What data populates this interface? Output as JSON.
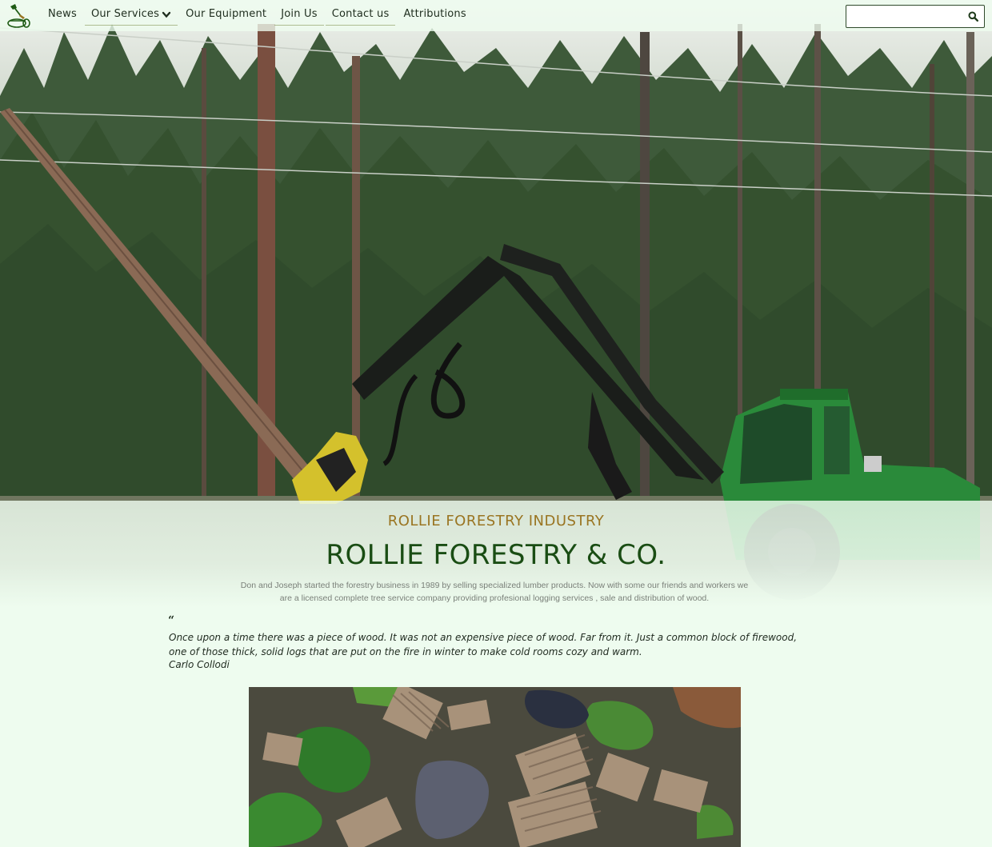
{
  "nav": {
    "logo_icon": "log-and-axe-icon",
    "items": [
      {
        "label": "News"
      },
      {
        "label": "Our Services",
        "has_dropdown": true
      },
      {
        "label": "Our Equipment"
      },
      {
        "label": "Join Us"
      },
      {
        "label": "Contact us"
      },
      {
        "label": "Attributions"
      }
    ],
    "search": {
      "placeholder": "",
      "value": "",
      "icon": "search-icon"
    }
  },
  "hero": {
    "image": "forest-harvester-photo",
    "kicker": "ROLLIE FORESTRY INDUSTRY",
    "title": "ROLLIE FORESTRY & CO.",
    "intro": "Don and Joseph started the forestry business in 1989 by selling specialized lumber products. Now with some our friends and workers we are a licensed complete tree service company providing profesional logging services , sale and distribution of wood."
  },
  "quote": {
    "mark": "“",
    "text": "Once upon a time there was a piece of wood. It was not an expensive piece of wood. Far from it. Just a common block of firewood, one of those thick, solid logs that are put on the fire in winter to make cold rooms cozy and warm.",
    "author": "Carlo Collodi"
  },
  "gallery": {
    "image": "aerial-log-yard-photo"
  },
  "colors": {
    "background": "#eefcef",
    "kicker": "#9a7522",
    "title": "#1a4d14",
    "nav_text": "#1e2d1e",
    "harvester_green": "#2a8a3a"
  }
}
